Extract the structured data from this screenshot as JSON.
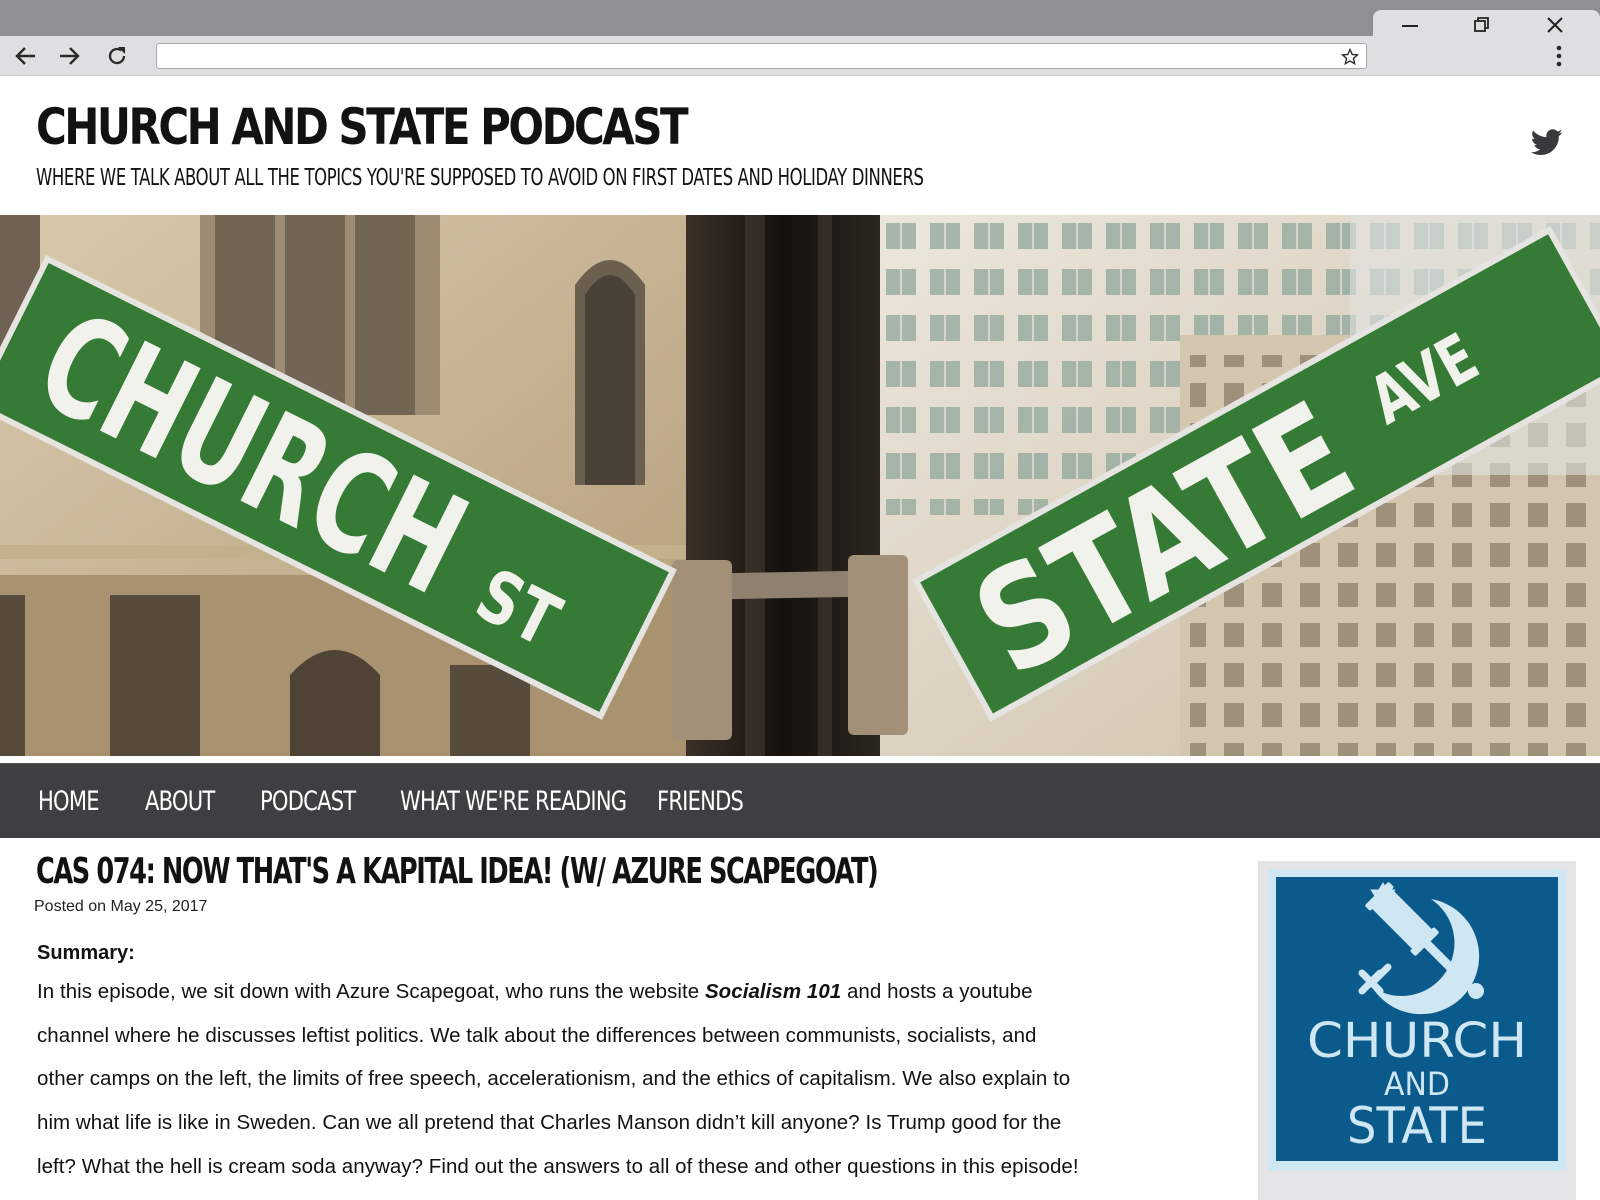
{
  "browser": {
    "url": "",
    "controls": {
      "minimize": "minimize-icon",
      "restore": "restore-icon",
      "close": "close-icon"
    }
  },
  "site": {
    "title": "CHURCH AND STATE PODCAST",
    "tagline": "WHERE WE TALK ABOUT ALL THE TOPICS YOU'RE SUPPOSED TO AVOID ON FIRST DATES AND HOLIDAY DINNERS",
    "social_icon": "twitter-icon"
  },
  "hero": {
    "sign_left": {
      "main": "CHURCH",
      "suffix": "ST"
    },
    "sign_right": {
      "main": "STATE",
      "suffix": "AVE"
    }
  },
  "nav": {
    "items": [
      {
        "label": "HOME"
      },
      {
        "label": "ABOUT"
      },
      {
        "label": "PODCAST"
      },
      {
        "label": "WHAT WE'RE READING"
      },
      {
        "label": "FRIENDS"
      }
    ]
  },
  "post": {
    "title": "CAS 074: NOW THAT'S A KAPITAL IDEA! (W/ AZURE SCAPEGOAT)",
    "meta": "Posted on May 25, 2017",
    "summary_label": "Summary:",
    "summary_lines": [
      {
        "before": "In this episode, we sit down with Azure Scapegoat, who runs the website ",
        "emph": "Socialism 101",
        "after": " and hosts a youtube"
      },
      {
        "text": "channel where he discusses leftist politics. We talk about the differences between communists, socialists, and"
      },
      {
        "text": "other camps on the left, the limits of free speech, accelerationism, and the ethics of capitalism. We also explain to"
      },
      {
        "text": "him what life is like in Sweden. Can we all pretend that Charles Manson didn’t kill anyone? Is Trump good for the"
      },
      {
        "text": "left? What the hell is cream soda anyway? Find out the answers to all of these and other questions in this episode!"
      }
    ]
  },
  "sidebar": {
    "logo": {
      "line1": "CHURCH",
      "line2": "AND",
      "line3": "STATE"
    }
  }
}
